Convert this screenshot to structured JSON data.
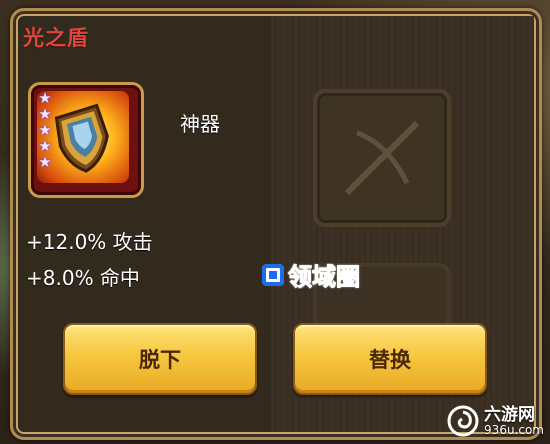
{
  "dialog": {
    "title": "光之盾",
    "item": {
      "type_label": "神器",
      "star_count": 5,
      "icon": "shield-icon"
    },
    "stats": [
      "+12.0% 攻击",
      "+8.0% 命中"
    ],
    "buttons": {
      "unequip_label": "脱下",
      "replace_label": "替换"
    }
  },
  "watermark": {
    "text": "领域圈"
  },
  "corner_logo": {
    "main": "六游网",
    "sub": "936u.com"
  },
  "colors": {
    "title": "#e2433c",
    "button": "#f6c73f",
    "frame": "#b08a52"
  }
}
